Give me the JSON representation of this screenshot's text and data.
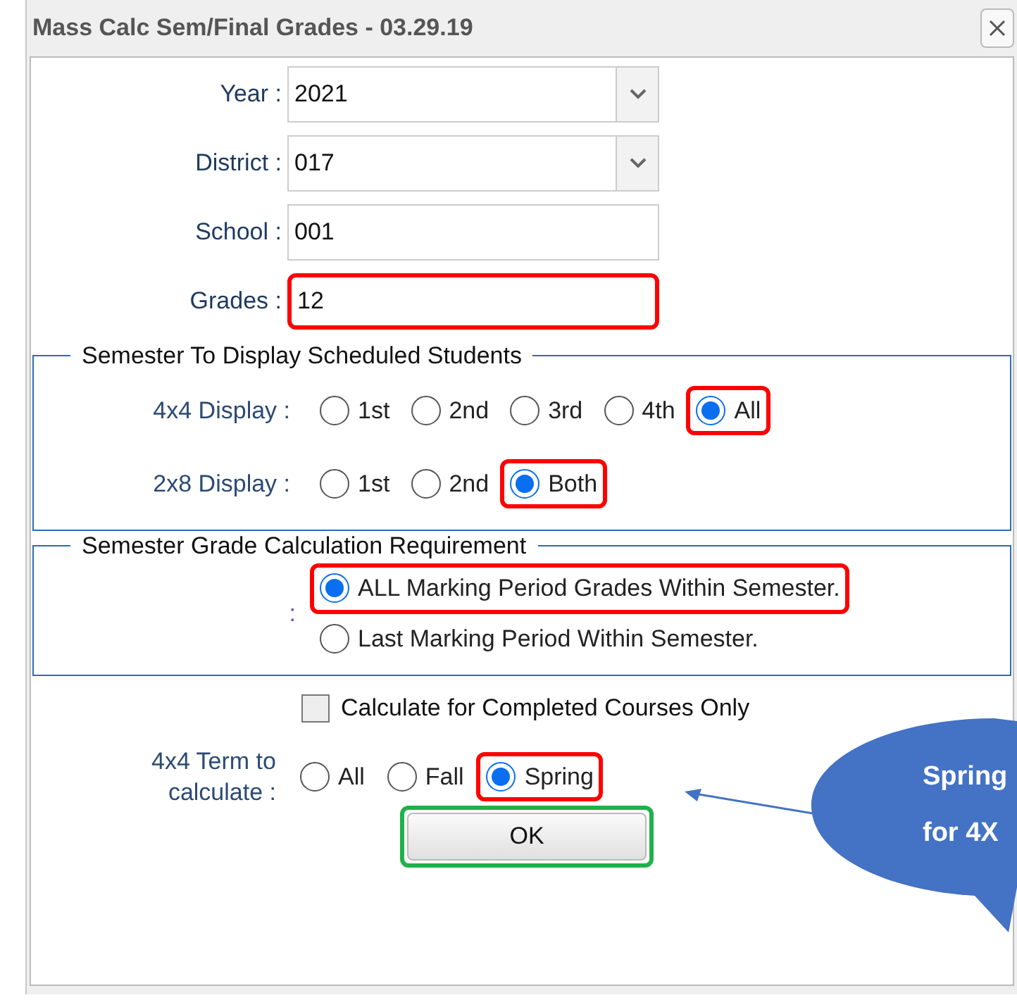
{
  "window": {
    "title": "Mass Calc Sem/Final Grades - 03.29.19"
  },
  "fields": [
    {
      "label": "Year :",
      "value": "2021",
      "kind": "dropdown"
    },
    {
      "label": "District :",
      "value": "017",
      "kind": "dropdown"
    },
    {
      "label": "School :",
      "value": "001",
      "kind": "text"
    },
    {
      "label": "Grades :",
      "value": "12",
      "kind": "text",
      "color": "#ff0000"
    }
  ],
  "semester_display": {
    "legend": "Semester To Display Scheduled Students",
    "rows": [
      {
        "label": "4x4 Display :",
        "options": [
          {
            "label": "1st",
            "selected": false
          },
          {
            "label": "2nd",
            "selected": false
          },
          {
            "label": "3rd",
            "selected": false
          },
          {
            "label": "4th",
            "selected": false
          },
          {
            "label": "All",
            "selected": true,
            "color": "#ff0000"
          }
        ]
      },
      {
        "label": "2x8 Display :",
        "options": [
          {
            "label": "1st",
            "selected": false
          },
          {
            "label": "2nd",
            "selected": false
          },
          {
            "label": "Both",
            "selected": true,
            "color": "#ff0000"
          }
        ]
      }
    ]
  },
  "calc_requirement": {
    "legend": "Semester Grade Calculation Requirement",
    "label": ":",
    "options": [
      {
        "label": "ALL Marking Period Grades Within Semester.",
        "selected": true,
        "color": "#ff0000"
      },
      {
        "label": "Last Marking Period Within Semester.",
        "selected": false
      }
    ]
  },
  "completed_only": {
    "label": "Calculate for Completed Courses Only",
    "checked": false
  },
  "term": {
    "label": "4x4 Term to calculate :",
    "options": [
      {
        "label": "All",
        "selected": false
      },
      {
        "label": "Fall",
        "selected": false
      },
      {
        "label": "Spring",
        "selected": true,
        "color": "#ff0000"
      }
    ]
  },
  "ok_button": {
    "label": "OK",
    "color": "#1fb14a"
  },
  "callout": {
    "lines": [
      "Spring",
      "for 4X"
    ]
  }
}
